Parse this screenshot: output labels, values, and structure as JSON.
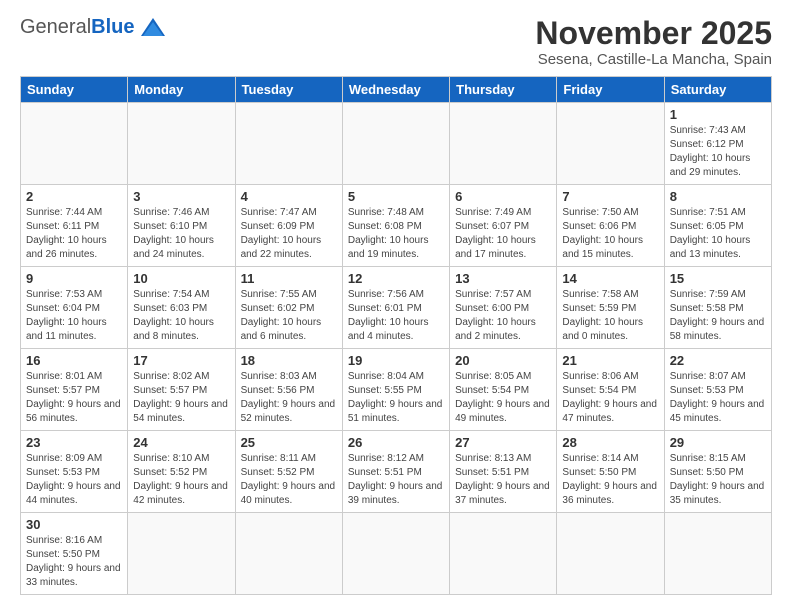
{
  "header": {
    "logo_general": "General",
    "logo_blue": "Blue",
    "month": "November 2025",
    "location": "Sesena, Castille-La Mancha, Spain"
  },
  "days_of_week": [
    "Sunday",
    "Monday",
    "Tuesday",
    "Wednesday",
    "Thursday",
    "Friday",
    "Saturday"
  ],
  "weeks": [
    [
      null,
      null,
      null,
      null,
      null,
      null,
      {
        "day": 1,
        "sunrise": "7:43 AM",
        "sunset": "6:12 PM",
        "daylight": "10 hours and 29 minutes."
      }
    ],
    [
      {
        "day": 2,
        "sunrise": "7:44 AM",
        "sunset": "6:11 PM",
        "daylight": "10 hours and 26 minutes."
      },
      {
        "day": 3,
        "sunrise": "7:46 AM",
        "sunset": "6:10 PM",
        "daylight": "10 hours and 24 minutes."
      },
      {
        "day": 4,
        "sunrise": "7:47 AM",
        "sunset": "6:09 PM",
        "daylight": "10 hours and 22 minutes."
      },
      {
        "day": 5,
        "sunrise": "7:48 AM",
        "sunset": "6:08 PM",
        "daylight": "10 hours and 19 minutes."
      },
      {
        "day": 6,
        "sunrise": "7:49 AM",
        "sunset": "6:07 PM",
        "daylight": "10 hours and 17 minutes."
      },
      {
        "day": 7,
        "sunrise": "7:50 AM",
        "sunset": "6:06 PM",
        "daylight": "10 hours and 15 minutes."
      },
      {
        "day": 8,
        "sunrise": "7:51 AM",
        "sunset": "6:05 PM",
        "daylight": "10 hours and 13 minutes."
      }
    ],
    [
      {
        "day": 9,
        "sunrise": "7:53 AM",
        "sunset": "6:04 PM",
        "daylight": "10 hours and 11 minutes."
      },
      {
        "day": 10,
        "sunrise": "7:54 AM",
        "sunset": "6:03 PM",
        "daylight": "10 hours and 8 minutes."
      },
      {
        "day": 11,
        "sunrise": "7:55 AM",
        "sunset": "6:02 PM",
        "daylight": "10 hours and 6 minutes."
      },
      {
        "day": 12,
        "sunrise": "7:56 AM",
        "sunset": "6:01 PM",
        "daylight": "10 hours and 4 minutes."
      },
      {
        "day": 13,
        "sunrise": "7:57 AM",
        "sunset": "6:00 PM",
        "daylight": "10 hours and 2 minutes."
      },
      {
        "day": 14,
        "sunrise": "7:58 AM",
        "sunset": "5:59 PM",
        "daylight": "10 hours and 0 minutes."
      },
      {
        "day": 15,
        "sunrise": "7:59 AM",
        "sunset": "5:58 PM",
        "daylight": "9 hours and 58 minutes."
      }
    ],
    [
      {
        "day": 16,
        "sunrise": "8:01 AM",
        "sunset": "5:57 PM",
        "daylight": "9 hours and 56 minutes."
      },
      {
        "day": 17,
        "sunrise": "8:02 AM",
        "sunset": "5:57 PM",
        "daylight": "9 hours and 54 minutes."
      },
      {
        "day": 18,
        "sunrise": "8:03 AM",
        "sunset": "5:56 PM",
        "daylight": "9 hours and 52 minutes."
      },
      {
        "day": 19,
        "sunrise": "8:04 AM",
        "sunset": "5:55 PM",
        "daylight": "9 hours and 51 minutes."
      },
      {
        "day": 20,
        "sunrise": "8:05 AM",
        "sunset": "5:54 PM",
        "daylight": "9 hours and 49 minutes."
      },
      {
        "day": 21,
        "sunrise": "8:06 AM",
        "sunset": "5:54 PM",
        "daylight": "9 hours and 47 minutes."
      },
      {
        "day": 22,
        "sunrise": "8:07 AM",
        "sunset": "5:53 PM",
        "daylight": "9 hours and 45 minutes."
      }
    ],
    [
      {
        "day": 23,
        "sunrise": "8:09 AM",
        "sunset": "5:53 PM",
        "daylight": "9 hours and 44 minutes."
      },
      {
        "day": 24,
        "sunrise": "8:10 AM",
        "sunset": "5:52 PM",
        "daylight": "9 hours and 42 minutes."
      },
      {
        "day": 25,
        "sunrise": "8:11 AM",
        "sunset": "5:52 PM",
        "daylight": "9 hours and 40 minutes."
      },
      {
        "day": 26,
        "sunrise": "8:12 AM",
        "sunset": "5:51 PM",
        "daylight": "9 hours and 39 minutes."
      },
      {
        "day": 27,
        "sunrise": "8:13 AM",
        "sunset": "5:51 PM",
        "daylight": "9 hours and 37 minutes."
      },
      {
        "day": 28,
        "sunrise": "8:14 AM",
        "sunset": "5:50 PM",
        "daylight": "9 hours and 36 minutes."
      },
      {
        "day": 29,
        "sunrise": "8:15 AM",
        "sunset": "5:50 PM",
        "daylight": "9 hours and 35 minutes."
      }
    ],
    [
      {
        "day": 30,
        "sunrise": "8:16 AM",
        "sunset": "5:50 PM",
        "daylight": "9 hours and 33 minutes."
      },
      null,
      null,
      null,
      null,
      null,
      null
    ]
  ]
}
